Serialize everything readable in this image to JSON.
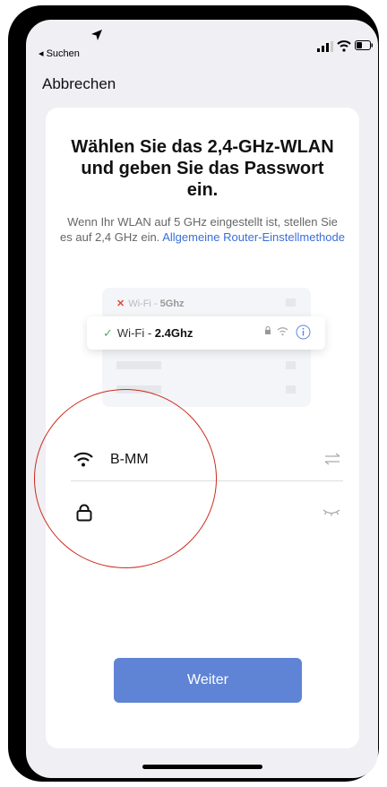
{
  "status_bar": {
    "back_app_label": "◂ Suchen",
    "icons": [
      "location-arrow-icon",
      "signal-icon",
      "wifi-status-icon",
      "battery-icon"
    ]
  },
  "nav": {
    "cancel_label": "Abbrechen"
  },
  "content": {
    "title": "Wählen Sie das 2,4-GHz-WLAN und geben Sie das Passwort ein.",
    "subtitle": "Wenn Ihr WLAN auf 5 GHz eingestellt ist, stellen Sie es auf 2,4 GHz ein.",
    "subtitle_link": "Allgemeine Router-Einstellmethode"
  },
  "illustration": {
    "row_5ghz": {
      "prefix": "Wi-Fi - ",
      "band": "5Ghz"
    },
    "row_24ghz": {
      "prefix": "Wi-Fi - ",
      "band": "2.4Ghz"
    }
  },
  "form": {
    "ssid_value": "B-MM",
    "password_value": ""
  },
  "next_button_label": "Weiter",
  "colors": {
    "accent": "#3a6fd8",
    "button": "#5f84d5",
    "annotation_circle": "#cc2a1a"
  }
}
